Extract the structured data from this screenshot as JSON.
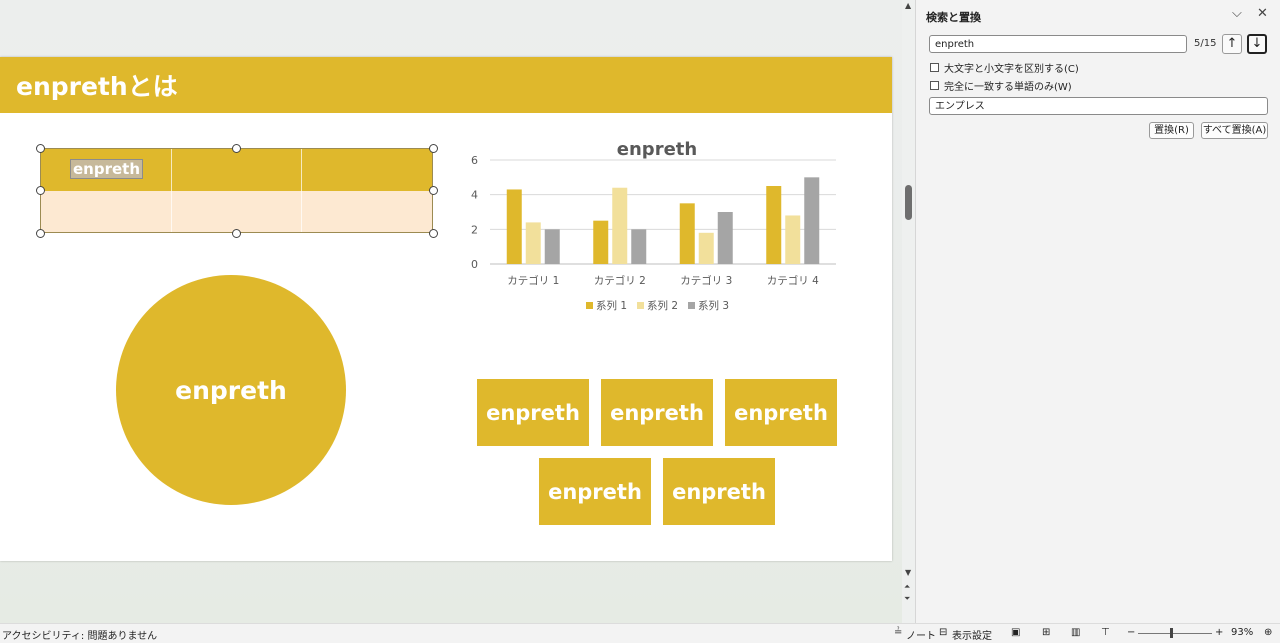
{
  "slide": {
    "title": "enprethとは",
    "table_cell_text": "enpreth",
    "circle_text": "enpreth",
    "boxes": [
      "enpreth",
      "enpreth",
      "enpreth",
      "enpreth",
      "enpreth"
    ]
  },
  "chart_data": {
    "type": "bar",
    "title": "enpreth",
    "categories": [
      "カテゴリ 1",
      "カテゴリ 2",
      "カテゴリ 3",
      "カテゴリ 4"
    ],
    "series": [
      {
        "name": "系列 1",
        "values": [
          4.3,
          2.5,
          3.5,
          4.5
        ],
        "color": "#dfb82c"
      },
      {
        "name": "系列 2",
        "values": [
          2.4,
          4.4,
          1.8,
          2.8
        ],
        "color": "#f2e09b"
      },
      {
        "name": "系列 3",
        "values": [
          2.0,
          2.0,
          3.0,
          5.0
        ],
        "color": "#a5a5a5"
      }
    ],
    "yticks": [
      "0",
      "2",
      "4",
      "6"
    ],
    "ylim": [
      0,
      6
    ],
    "grid": true,
    "legend_position": "bottom"
  },
  "find_pane": {
    "title": "検索と置換",
    "find_value": "enpreth",
    "match_count": "5/15",
    "option_case": "大文字と小文字を区別する(C)",
    "option_whole_word": "完全に一致する単語のみ(W)",
    "replace_value": "エンプレス",
    "replace_button": "置換(R)",
    "replace_all_button": "すべて置換(A)",
    "icons": {
      "collapse": "chevron-down-icon",
      "close": "close-icon",
      "prev": "arrow-up-icon",
      "next": "arrow-down-icon"
    }
  },
  "status_bar": {
    "accessibility": "アクセシビリティ: 問題ありません",
    "notes": "ノート",
    "display_settings": "表示設定",
    "zoom": "93%"
  },
  "colors": {
    "accent": "#dfb82c",
    "table_body": "#fde9d2"
  }
}
